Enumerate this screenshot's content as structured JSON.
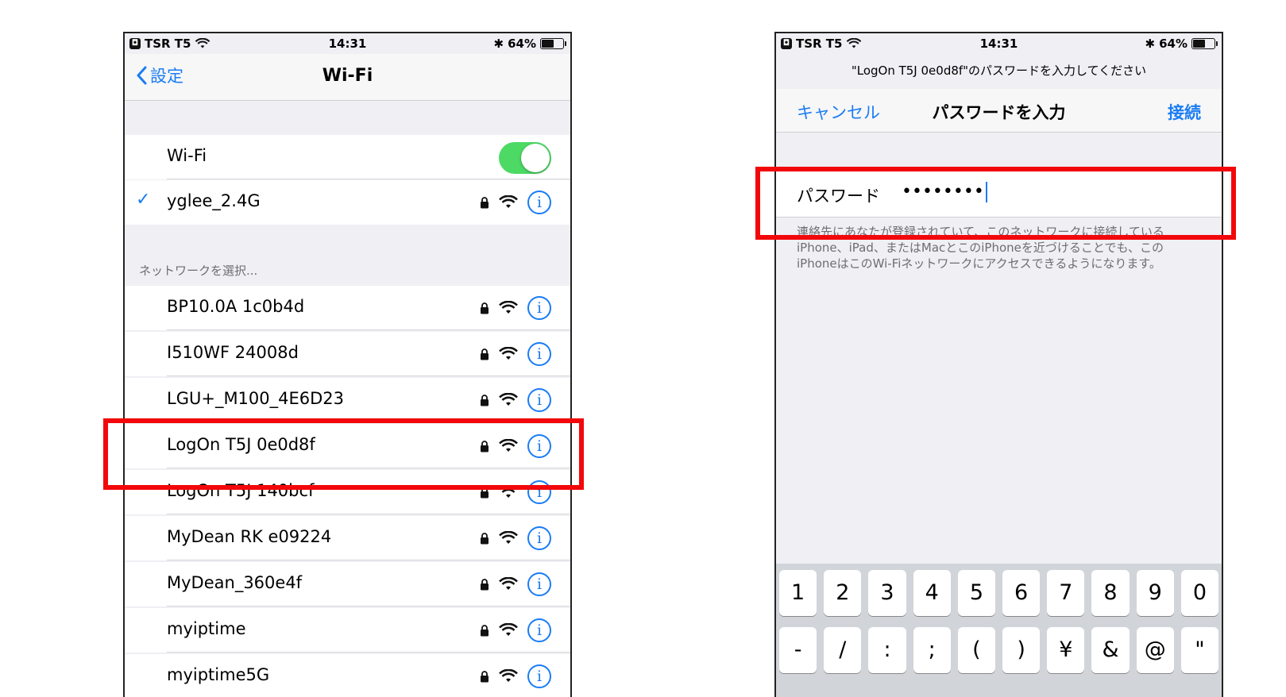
{
  "left": {
    "status": {
      "carrier": "TSR T5",
      "time": "14:31",
      "battery": "64%",
      "battery_level": 0.64
    },
    "nav": {
      "back_label": "設定",
      "title": "Wi-Fi"
    },
    "wifi_toggle": {
      "label": "Wi-Fi",
      "on": true
    },
    "connected": {
      "name": "yglee_2.4G"
    },
    "section_header": "ネットワークを選択...",
    "networks": [
      {
        "name": "BP10.0A 1c0b4d"
      },
      {
        "name": "I510WF 24008d"
      },
      {
        "name": "LGU+_M100_4E6D23"
      },
      {
        "name": "LogOn T5J 0e0d8f"
      },
      {
        "name": "LogOn T5J 140bcf"
      },
      {
        "name": "MyDean RK e09224"
      },
      {
        "name": "MyDean_360e4f"
      },
      {
        "name": "myiptime"
      },
      {
        "name": "myiptime5G"
      }
    ],
    "info_glyph": "i"
  },
  "right": {
    "status": {
      "carrier": "TSR T5",
      "time": "14:31",
      "battery": "64%",
      "battery_level": 0.64
    },
    "prompt": "\"LogOn T5J 0e0d8f\"のパスワードを入力してください",
    "nav": {
      "cancel": "キャンセル",
      "title": "パスワードを入力",
      "join": "接続"
    },
    "password": {
      "label": "パスワード",
      "value": "••••••••"
    },
    "note": "連絡先にあなたが登録されていて、このネットワークに接続しているiPhone、iPad、またはMacとこのiPhoneを近づけることでも、このiPhoneはこのWi-Fiネットワークにアクセスできるようになります。",
    "keyboard": {
      "row1": [
        "1",
        "2",
        "3",
        "4",
        "5",
        "6",
        "7",
        "8",
        "9",
        "0"
      ],
      "row2": [
        "-",
        "/",
        ":",
        ";",
        "(",
        ")",
        "¥",
        "&",
        "@",
        "\""
      ]
    }
  },
  "colors": {
    "accent": "#1a7cf5",
    "toggle_on": "#4cd964",
    "highlight": "#f2080b"
  }
}
